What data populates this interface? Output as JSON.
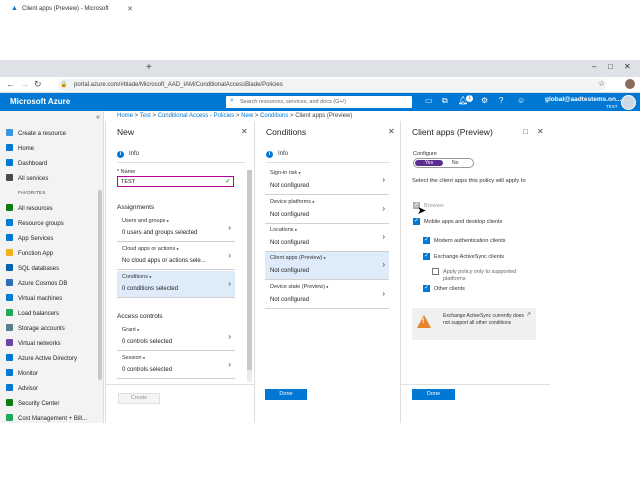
{
  "browser": {
    "tab_title": "Client apps (Preview) - Microsoft",
    "url": "portal.azure.com/#blade/Microsoft_AAD_IAM/ConditionalAccessBlade/Policies"
  },
  "azure": {
    "brand": "Microsoft Azure",
    "search_placeholder": "Search resources, services, and docs (G+/)",
    "notification_count": "1",
    "user_email": "global@aadtestems.on...",
    "user_tenant": "TEST"
  },
  "breadcrumb": [
    "Home",
    "Test",
    "Conditional Access - Policies",
    "New",
    "Conditions",
    "Client apps (Preview)"
  ],
  "nav": {
    "items": [
      {
        "label": "Create a resource",
        "color": "#3a96dd"
      },
      {
        "label": "Home",
        "color": "#0078d4"
      },
      {
        "label": "Dashboard",
        "color": "#0078d4"
      },
      {
        "label": "All services",
        "color": "#4a4a4a"
      },
      {
        "label": "All resources",
        "color": "#107c10"
      },
      {
        "label": "Resource groups",
        "color": "#0078d4"
      },
      {
        "label": "App Services",
        "color": "#0078d4"
      },
      {
        "label": "Function App",
        "color": "#f2b01e"
      },
      {
        "label": "SQL databases",
        "color": "#0063b1"
      },
      {
        "label": "Azure Cosmos DB",
        "color": "#2f6fb5"
      },
      {
        "label": "Virtual machines",
        "color": "#0078d4"
      },
      {
        "label": "Load balancers",
        "color": "#22a85b"
      },
      {
        "label": "Storage accounts",
        "color": "#5c7d8b"
      },
      {
        "label": "Virtual networks",
        "color": "#6b46a3"
      },
      {
        "label": "Azure Active Directory",
        "color": "#0078d4"
      },
      {
        "label": "Monitor",
        "color": "#0078d4"
      },
      {
        "label": "Advisor",
        "color": "#0078d4"
      },
      {
        "label": "Security Center",
        "color": "#107c10"
      },
      {
        "label": "Cost Management + Bill...",
        "color": "#22a85b"
      }
    ],
    "favorites_label": "FAVORITES"
  },
  "blade_new": {
    "title": "New",
    "info": "Info",
    "name_label": "* Name",
    "name_value": "TEST",
    "assignments_label": "Assignments",
    "rows": [
      {
        "label": "Users and groups",
        "value": "0 users and groups selected"
      },
      {
        "label": "Cloud apps or actions",
        "value": "No cloud apps or actions sele..."
      },
      {
        "label": "Conditions",
        "value": "0 conditions selected"
      }
    ],
    "access_controls_label": "Access controls",
    "access_rows": [
      {
        "label": "Grant",
        "value": "0 controls selected"
      },
      {
        "label": "Session",
        "value": "0 controls selected"
      }
    ],
    "create_label": "Create"
  },
  "blade_conditions": {
    "title": "Conditions",
    "info": "Info",
    "rows": [
      {
        "label": "Sign-in risk",
        "value": "Not configured"
      },
      {
        "label": "Device platforms",
        "value": "Not configured"
      },
      {
        "label": "Locations",
        "value": "Not configured"
      },
      {
        "label": "Client apps (Preview)",
        "value": "Not configured"
      },
      {
        "label": "Device state (Preview)",
        "value": "Not configured"
      }
    ],
    "done_label": "Done"
  },
  "blade_client_apps": {
    "title": "Client apps (Preview)",
    "configure_label": "Configure",
    "toggle_yes": "Yes",
    "toggle_no": "No",
    "description": "Select the client apps this policy will apply to",
    "checkboxes": [
      {
        "label": "Browser",
        "state": "grey"
      },
      {
        "label": "Mobile apps and desktop clients",
        "state": "on"
      },
      {
        "label": "Modern authentication clients",
        "state": "on"
      },
      {
        "label": "Exchange ActiveSync clients",
        "state": "on"
      },
      {
        "label": "Apply policy only to supported platforms",
        "state": "off"
      },
      {
        "label": "Other clients",
        "state": "on"
      }
    ],
    "warning": "Exchange ActiveSync currently does not support all other conditions",
    "done_label": "Done"
  }
}
